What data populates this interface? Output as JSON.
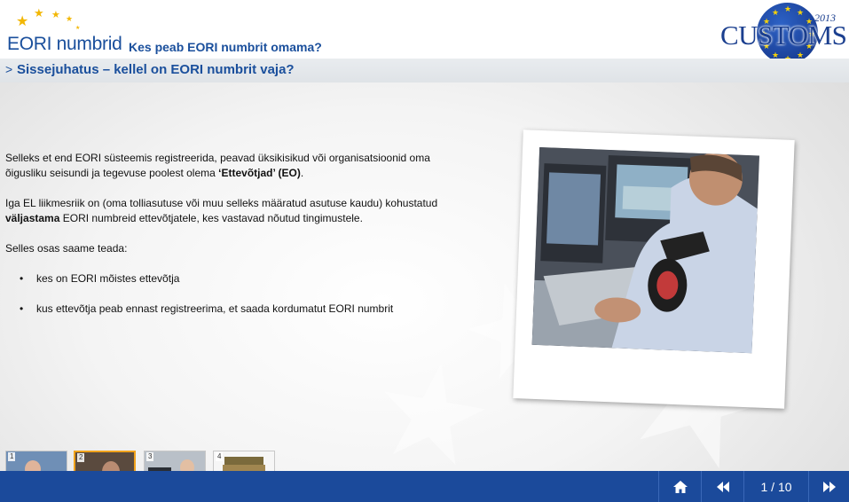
{
  "header": {
    "module_title": "EORI numbrid",
    "module_subtitle": "Kes peab EORI numbrit omama?",
    "logo_word": "CUSTOMS",
    "logo_year": "2013"
  },
  "section": {
    "arrow": ">",
    "title": "Sissejuhatus – kellel on EORI numbrit vaja?"
  },
  "content": {
    "p1_a": "Selleks et end EORI süsteemis registreerida, peavad üksikisikud või organisatsioonid oma õigusliku seisundi ja tegevuse poolest olema ",
    "p1_bold": "‘Ettevõtjad’ (EO)",
    "p1_end": ".",
    "p2_a": "Iga EL liikmesriik on (oma tolliasutuse või muu selleks määratud asutuse kaudu) kohustatud ",
    "p2_bold": "väljastama",
    "p2_b": " EORI numbreid ettevõtjatele, kes vastavad nõutud tingimustele.",
    "p3": "Selles osas saame teada:",
    "bullets": [
      "kes on EORI mõistes ettevõtja",
      "kus ettevõtja peab ennast registreerima, et saada kordumatut EORI numbrit"
    ],
    "bullet_glyph": "•"
  },
  "thumbnails": [
    {
      "number": "1",
      "subject": "customs-officer-thumbnail"
    },
    {
      "number": "2",
      "subject": "woman-portrait-thumbnail"
    },
    {
      "number": "3",
      "subject": "woman-at-computer-thumbnail"
    },
    {
      "number": "4",
      "subject": "book-stack-thumbnail"
    }
  ],
  "active_thumbnail": "2",
  "footer": {
    "page_indicator": "1 / 10",
    "home_icon": "home-icon",
    "prev_icon": "rewind-icon",
    "next_icon": "fast-forward-icon"
  },
  "colors": {
    "brand_blue": "#1a4f9c",
    "footer_blue": "#1b4a9b",
    "star_gold": "#f2b705",
    "active_border": "#f0a21c"
  }
}
